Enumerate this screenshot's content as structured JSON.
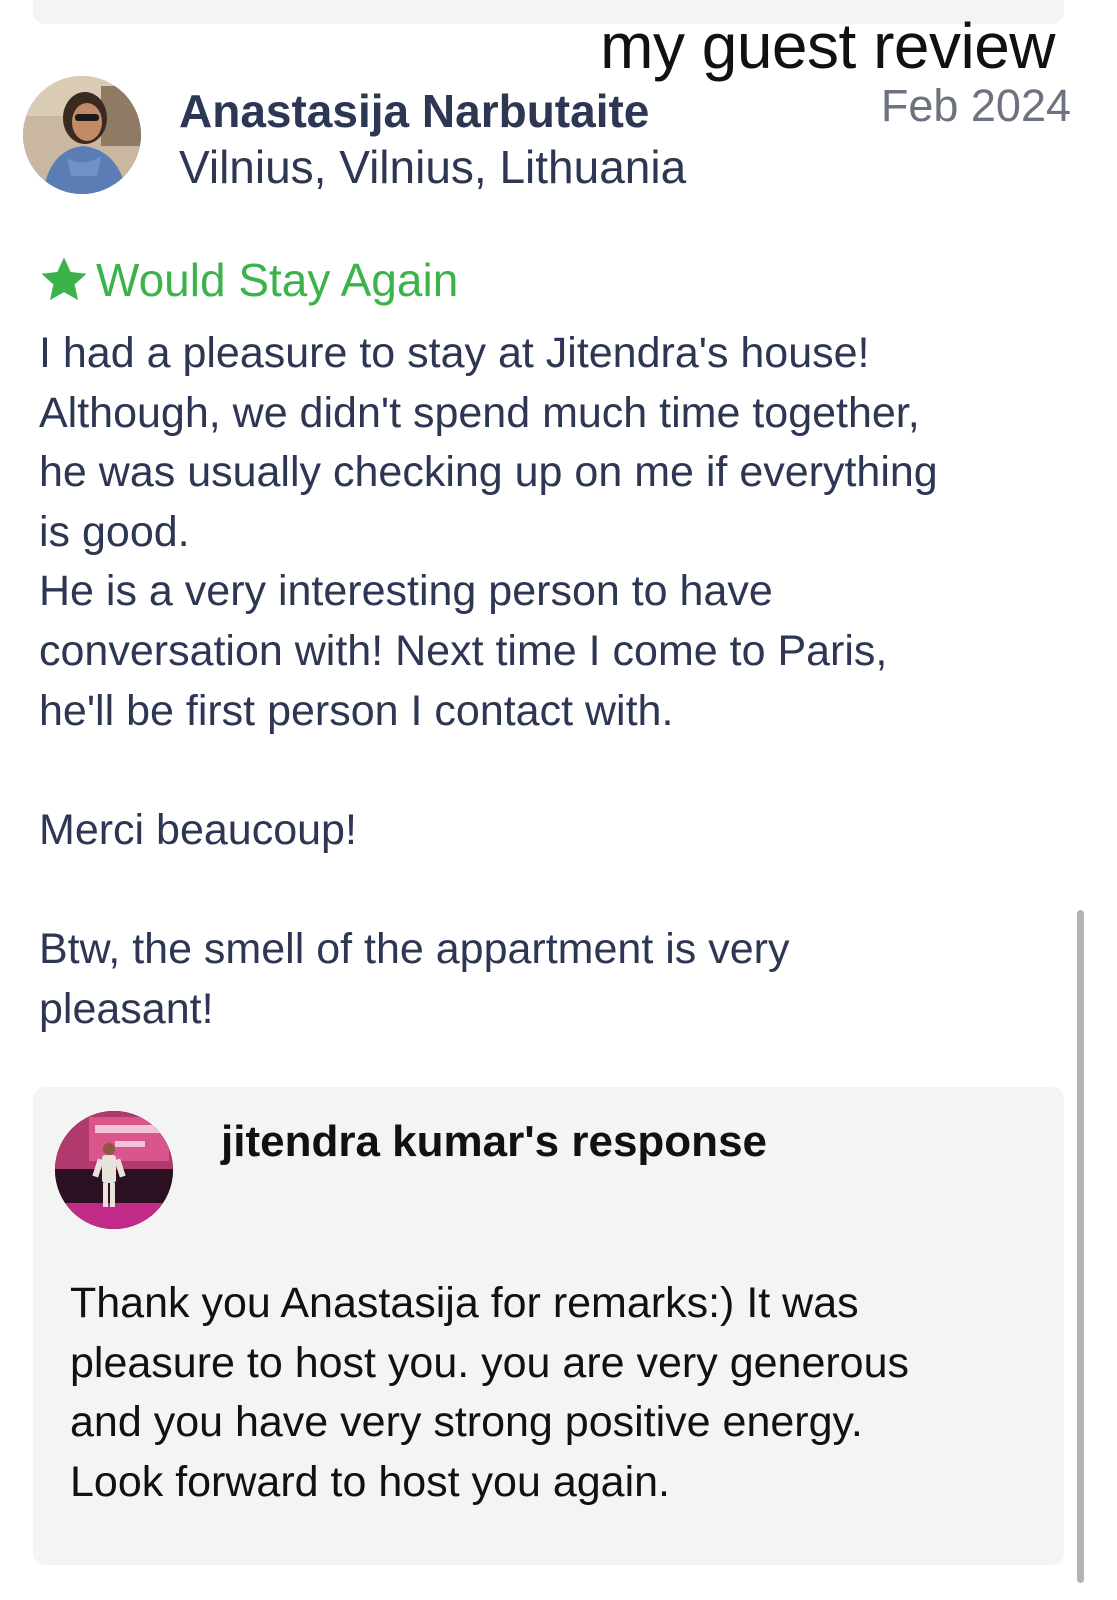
{
  "overlay_caption": "my guest review",
  "review": {
    "reviewer_name": "Anastasija Narbutaite",
    "reviewer_location": "Vilnius, Vilnius, Lithuania",
    "date": "Feb 2024",
    "recommendation_label": "Would Stay Again",
    "recommendation_icon": "star-icon",
    "body_lines": [
      "I had a pleasure to stay at Jitendra's house!",
      "Although, we didn't spend much time together,",
      "he was usually checking up on me if everything",
      "is good.",
      "He is a very interesting person to have",
      "conversation with! Next time I come to Paris,",
      "he'll be first person I contact with.",
      "",
      "Merci beaucoup!",
      "",
      "Btw, the smell of the appartment is very",
      "pleasant!"
    ]
  },
  "response": {
    "title": "jitendra kumar's response",
    "body_lines": [
      "Thank you Anastasija for remarks:) It was",
      "pleasure to host you. you are very generous",
      "and you have very strong positive energy.",
      "Look forward to host you again."
    ]
  },
  "colors": {
    "accent_green": "#3bb34a",
    "text_navy": "#2d3652",
    "date_gray": "#6d7280",
    "card_background": "#f4f4f4"
  }
}
